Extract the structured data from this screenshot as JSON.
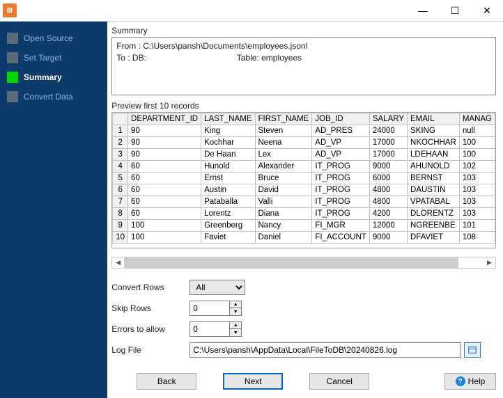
{
  "titlebar": {
    "icon_label": "⊞"
  },
  "win_controls": {
    "minimize": "—",
    "maximize": "☐",
    "close": "✕"
  },
  "sidebar": {
    "steps": [
      {
        "label": "Open Source"
      },
      {
        "label": "Set Target"
      },
      {
        "label": "Summary"
      },
      {
        "label": "Convert Data"
      }
    ]
  },
  "summary": {
    "heading": "Summary",
    "from_line": "From : C:\\Users\\pansh\\Documents\\employees.jsonl",
    "to_line": "To : DB:                                       Table: employees"
  },
  "preview": {
    "heading": "Preview first 10 records",
    "columns": [
      "DEPARTMENT_ID",
      "LAST_NAME",
      "FIRST_NAME",
      "JOB_ID",
      "SALARY",
      "EMAIL",
      "MANAG"
    ],
    "rows": [
      [
        "90",
        "King",
        "Steven",
        "AD_PRES",
        "24000",
        "SKING",
        "null"
      ],
      [
        "90",
        "Kochhar",
        "Neena",
        "AD_VP",
        "17000",
        "NKOCHHAR",
        "100"
      ],
      [
        "90",
        "De Haan",
        "Lex",
        "AD_VP",
        "17000",
        "LDEHAAN",
        "100"
      ],
      [
        "60",
        "Hunold",
        "Alexander",
        "IT_PROG",
        "9000",
        "AHUNOLD",
        "102"
      ],
      [
        "60",
        "Ernst",
        "Bruce",
        "IT_PROG",
        "6000",
        "BERNST",
        "103"
      ],
      [
        "60",
        "Austin",
        "David",
        "IT_PROG",
        "4800",
        "DAUSTIN",
        "103"
      ],
      [
        "60",
        "Pataballa",
        "Valli",
        "IT_PROG",
        "4800",
        "VPATABAL",
        "103"
      ],
      [
        "60",
        "Lorentz",
        "Diana",
        "IT_PROG",
        "4200",
        "DLORENTZ",
        "103"
      ],
      [
        "100",
        "Greenberg",
        "Nancy",
        "FI_MGR",
        "12000",
        "NGREENBE",
        "101"
      ],
      [
        "100",
        "Faviet",
        "Daniel",
        "FI_ACCOUNT",
        "9000",
        "DFAVIET",
        "108"
      ]
    ]
  },
  "form": {
    "convert_rows_label": "Convert Rows",
    "convert_rows_value": "All",
    "skip_rows_label": "Skip Rows",
    "skip_rows_value": "0",
    "errors_label": "Errors to allow",
    "errors_value": "0",
    "logfile_label": "Log File",
    "logfile_value": "C:\\Users\\pansh\\AppData\\Local\\FileToDB\\20240826.log"
  },
  "buttons": {
    "back": "Back",
    "next": "Next",
    "cancel": "Cancel",
    "help": "Help"
  }
}
